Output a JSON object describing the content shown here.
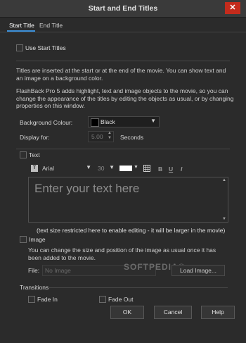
{
  "window": {
    "title": "Start and End Titles",
    "close_glyph": "✕"
  },
  "tabs": [
    {
      "label": "Start Title"
    },
    {
      "label": "End Title"
    }
  ],
  "use_start_titles": {
    "label": "Use Start Titles",
    "checked": false
  },
  "intro": {
    "p1": "Titles are inserted at the start or at the end of the movie. You can show text and an image on a background color.",
    "p2": "FlashBack Pro 5 adds highlight, text and image objects to the movie, so you can change the appearance of the titles by editing the objects as usual, or by changing properties on this window."
  },
  "background": {
    "label": "Background Colour:",
    "value": "Black",
    "swatch_color": "#000000"
  },
  "display_for": {
    "label": "Display for:",
    "value": "5.00",
    "unit": "Seconds"
  },
  "text_section": {
    "label": "Text",
    "checked": false,
    "font_name": "Arial",
    "font_size": "30",
    "text_color": "#ffffff",
    "bold_label": "B",
    "underline_label": "U",
    "italic_label": "I",
    "placeholder": "Enter your text here",
    "note": "(text size restricted here to enable editing - it will be larger in the movie)"
  },
  "image_section": {
    "label": "Image",
    "checked": false,
    "help": "You can change the size and position of the image as usual once it has been added to the movie.",
    "file_label": "File:",
    "file_value": "No Image",
    "load_button": "Load Image..."
  },
  "transitions": {
    "heading": "Transitions",
    "fade_in": {
      "label": "Fade In",
      "checked": false
    },
    "fade_out": {
      "label": "Fade Out",
      "checked": false
    }
  },
  "buttons": {
    "ok": "OK",
    "cancel": "Cancel",
    "help": "Help"
  },
  "watermark": "SOFTPEDIA®"
}
